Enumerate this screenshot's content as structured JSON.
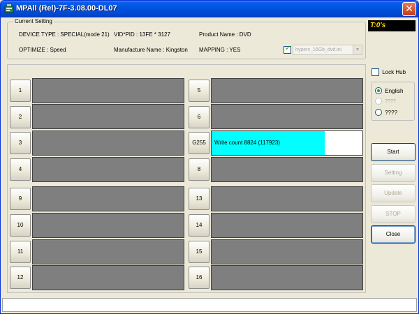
{
  "window": {
    "title": "MPAll (Rel)-7F-3.08.00-DL07",
    "close_glyph": "✕"
  },
  "current_setting": {
    "legend": "Current Setting",
    "device_type": "DEVICE TYPE : SPECIAL(mode 21)",
    "vid_pid": "VID*PID : 13FE * 3127",
    "product_name": "Product Name : DVD",
    "optimize": "OPTIMIZE : Speed",
    "manufacture_name": "Manufacture Name : Kingston",
    "mapping": "MAPPING : YES",
    "ini_checked": true,
    "ini_file": "hyperx_16Gb_dvd.ini",
    "combo_arrow": "▼"
  },
  "timer": "T:0's",
  "ports": [
    {
      "label": "1",
      "status": ""
    },
    {
      "label": "2",
      "status": ""
    },
    {
      "label": "3",
      "status": ""
    },
    {
      "label": "4",
      "status": ""
    },
    {
      "label": "5",
      "status": ""
    },
    {
      "label": "6",
      "status": ""
    },
    {
      "label": "G255",
      "status": "Write count 8824 (117923)",
      "progress": 0.75
    },
    {
      "label": "8",
      "status": ""
    },
    {
      "label": "9",
      "status": ""
    },
    {
      "label": "10",
      "status": ""
    },
    {
      "label": "11",
      "status": ""
    },
    {
      "label": "12",
      "status": ""
    },
    {
      "label": "13",
      "status": ""
    },
    {
      "label": "14",
      "status": ""
    },
    {
      "label": "15",
      "status": ""
    },
    {
      "label": "16",
      "status": ""
    }
  ],
  "options": {
    "lock_hub": "Lock Hub",
    "languages": [
      {
        "label": "English",
        "checked": true,
        "disabled": false
      },
      {
        "label": "????",
        "checked": false,
        "disabled": true
      },
      {
        "label": "????",
        "checked": false,
        "disabled": false
      }
    ]
  },
  "buttons": {
    "start": "Start",
    "setting": "Setting",
    "update": "Update",
    "stop": "STOP",
    "close": "Close"
  },
  "colors": {
    "progress_fill": "#00ffff",
    "idle_slot": "#7f7f7f",
    "timer_bg": "#000000",
    "timer_text": "#ffd700"
  },
  "status_bar": ""
}
